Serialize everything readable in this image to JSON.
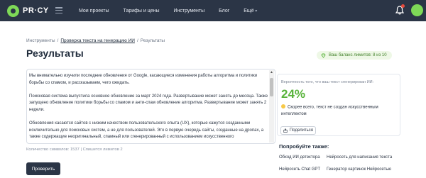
{
  "header": {
    "logo_text": "PR·CY",
    "nav": [
      "Мои проекты",
      "Тарифы и цены",
      "Инструменты",
      "Блог",
      "Ещё"
    ]
  },
  "breadcrumb": [
    "Инструменты",
    "Проверка текста на генерацию ИИ",
    "Результаты"
  ],
  "page_title": "Результаты",
  "balance": "Ваш баланс лимитов: 8 из 10",
  "input_text": {
    "paragraphs": [
      "Мы внимательно изучили последние обновления от Google, касающиеся изменения работы алгоритма и политики борьбы со спамом, и рассказываем, чего ожидать.",
      "Поисковая система выпустила основное обновление за март 2024 года. Развертывание может занять до месяца. Также запущено обновление политики борьбы со спамом и анти-спам обновление алгоритма. Развертывание может занять 2 недели.",
      "Обновления касаются сайтов с низким качеством пользовательского опыта (UX), которые кажутся созданными исключительно для поисковых систем, а не для пользователей. Это в первую очередь сайты, созданные на дропах, а также содержащие неоригинальный, спамный или сгенерированный с использованием искусственного"
    ]
  },
  "char_count": "Количество символов: 1537 | Спишется лимитов 2",
  "check_button": "Проверить",
  "result": {
    "label": "Вероятность того, что ваш текст сгенерирован ИИ:",
    "percent": "24%",
    "description": "Скорее всего, текст не создан искусственным интеллектом",
    "share_label": "Поделиться"
  },
  "try_also": {
    "title": "Попробуйте также:",
    "links": [
      "Обход ИИ детектора",
      "Нейросеть для написания текста",
      "Нейросеть Chat GPT",
      "Генератор картинок Нейросетью"
    ]
  },
  "colors": {
    "header_bg": "#2b3546",
    "accent_green": "#58b33a",
    "balance_bg": "#eef8e6"
  }
}
